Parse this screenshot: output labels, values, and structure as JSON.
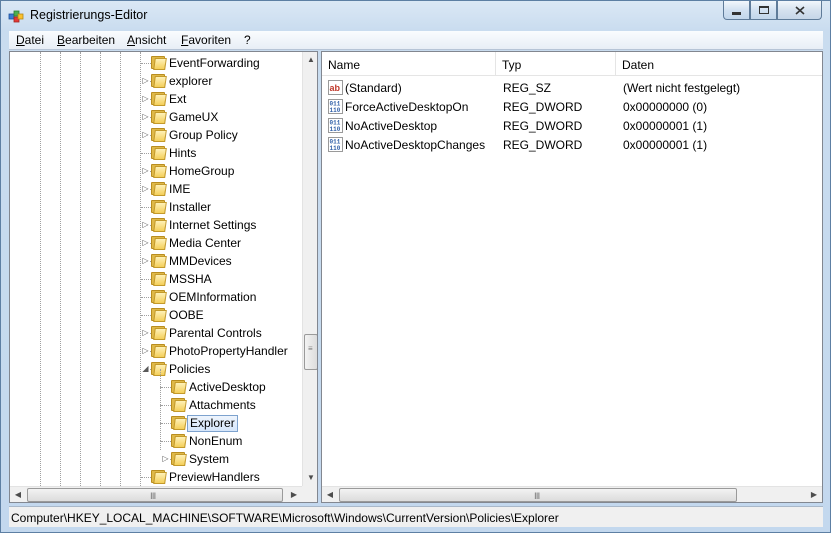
{
  "window": {
    "title": "Registrierungs-Editor",
    "controls": {
      "minimize": "—",
      "maximize": "□",
      "close": "✕"
    }
  },
  "menu": {
    "items": [
      "Datei",
      "Bearbeiten",
      "Ansicht",
      "Favoriten",
      "?"
    ]
  },
  "tree": {
    "items": [
      {
        "label": "EventForwarding",
        "level": 1,
        "expander": ""
      },
      {
        "label": "explorer",
        "level": 1,
        "expander": "▷"
      },
      {
        "label": "Ext",
        "level": 1,
        "expander": "▷"
      },
      {
        "label": "GameUX",
        "level": 1,
        "expander": "▷"
      },
      {
        "label": "Group Policy",
        "level": 1,
        "expander": "▷"
      },
      {
        "label": "Hints",
        "level": 1,
        "expander": ""
      },
      {
        "label": "HomeGroup",
        "level": 1,
        "expander": "▷"
      },
      {
        "label": "IME",
        "level": 1,
        "expander": "▷"
      },
      {
        "label": "Installer",
        "level": 1,
        "expander": ""
      },
      {
        "label": "Internet Settings",
        "level": 1,
        "expander": "▷"
      },
      {
        "label": "Media Center",
        "level": 1,
        "expander": "▷"
      },
      {
        "label": "MMDevices",
        "level": 1,
        "expander": "▷"
      },
      {
        "label": "MSSHA",
        "level": 1,
        "expander": ""
      },
      {
        "label": "OEMInformation",
        "level": 1,
        "expander": ""
      },
      {
        "label": "OOBE",
        "level": 1,
        "expander": ""
      },
      {
        "label": "Parental Controls",
        "level": 1,
        "expander": "▷"
      },
      {
        "label": "PhotoPropertyHandler",
        "level": 1,
        "expander": "▷"
      },
      {
        "label": "Policies",
        "level": 1,
        "expander": "◢"
      },
      {
        "label": "ActiveDesktop",
        "level": 2,
        "expander": ""
      },
      {
        "label": "Attachments",
        "level": 2,
        "expander": ""
      },
      {
        "label": "Explorer",
        "level": 2,
        "expander": "",
        "selected": true
      },
      {
        "label": "NonEnum",
        "level": 2,
        "expander": ""
      },
      {
        "label": "System",
        "level": 2,
        "expander": "▷"
      },
      {
        "label": "PreviewHandlers",
        "level": 1,
        "expander": ""
      }
    ],
    "scroll": {
      "up": "▲",
      "down": "▼",
      "left": "◀",
      "right": "▶",
      "grip": "≡"
    }
  },
  "list": {
    "columns": [
      "Name",
      "Typ",
      "Daten"
    ],
    "rows": [
      {
        "name": "(Standard)",
        "type": "REG_SZ",
        "data": "(Wert nicht festgelegt)",
        "icon": "string-value-icon",
        "icon_text": "ab"
      },
      {
        "name": "ForceActiveDesktopOn",
        "type": "REG_DWORD",
        "data": "0x00000000 (0)",
        "icon": "binary-value-icon",
        "icon_text": "011\n110"
      },
      {
        "name": "NoActiveDesktop",
        "type": "REG_DWORD",
        "data": "0x00000001 (1)",
        "icon": "binary-value-icon",
        "icon_text": "011\n110"
      },
      {
        "name": "NoActiveDesktopChanges",
        "type": "REG_DWORD",
        "data": "0x00000001 (1)",
        "icon": "binary-value-icon",
        "icon_text": "011\n110"
      }
    ]
  },
  "status": {
    "path": "Computer\\HKEY_LOCAL_MACHINE\\SOFTWARE\\Microsoft\\Windows\\CurrentVersion\\Policies\\Explorer"
  },
  "colors": {
    "selection_border": "#7da2ce",
    "folder": "#f4cf5a",
    "string_icon": "#c0392b",
    "binary_icon": "#2f5fa8"
  }
}
